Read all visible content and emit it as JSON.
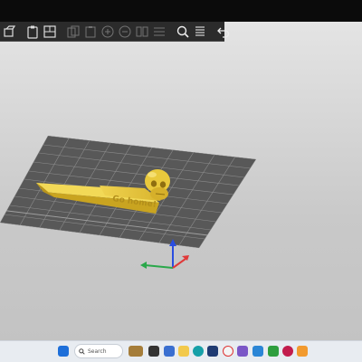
{
  "toolbar": {
    "icons": [
      "move-icon",
      "clipboard-icon",
      "layout-icon",
      "copy-icon",
      "paste-icon",
      "add-instance-icon",
      "remove-instance-icon",
      "split-icon",
      "variable-layer-icon",
      "search-icon",
      "layers-icon",
      "undo-icon"
    ]
  },
  "model": {
    "engraving": "Go home!"
  },
  "colors": {
    "background_top": "#e7e7e7",
    "bed": "#5a5a5a",
    "grid_line": "#8a8a8a",
    "model": "#e4c23a",
    "axis_x": "#e03a3a",
    "axis_y": "#2aa84a",
    "axis_z": "#2a4ee0"
  },
  "taskbar": {
    "search_placeholder": "Search",
    "apps": [
      "start-icon",
      "search",
      "weather-icon",
      "camera-icon",
      "files-icon",
      "edge-icon",
      "chrome-icon",
      "store-icon",
      "app-icon",
      "mail-icon",
      "xbox-icon",
      "raspberry-icon",
      "slicer-icon"
    ]
  }
}
